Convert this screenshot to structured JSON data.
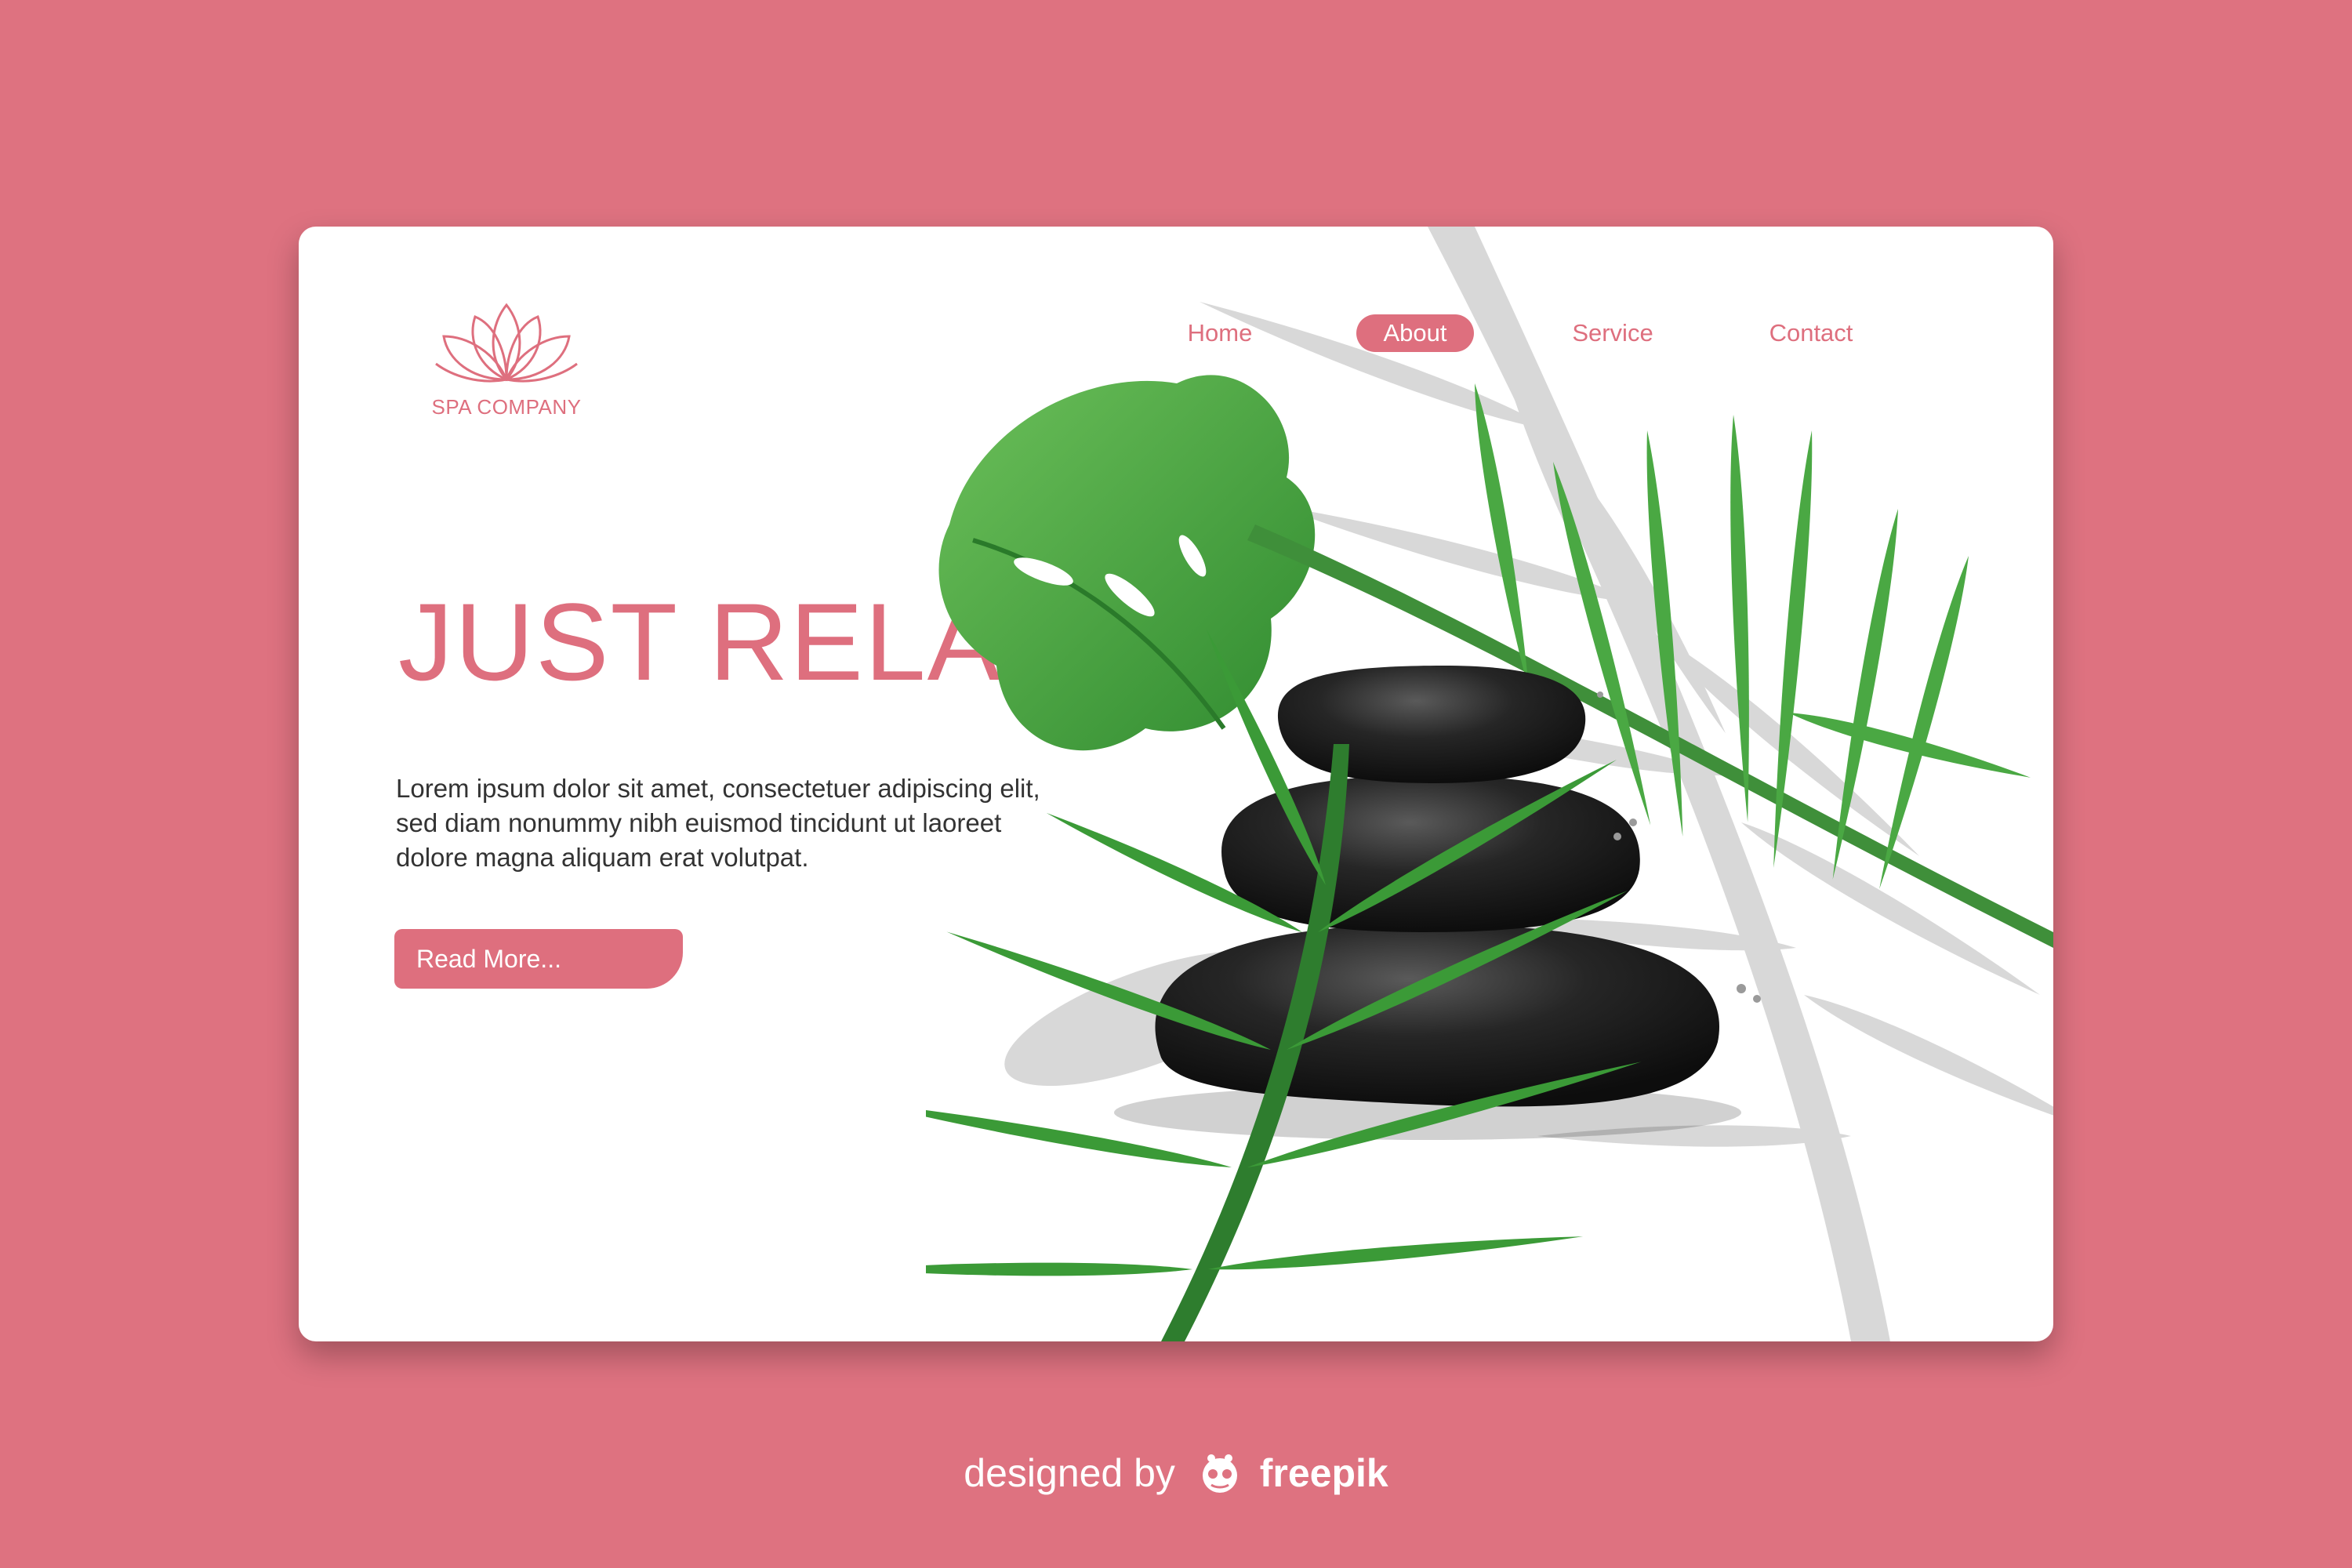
{
  "brand": {
    "name": "SPA COMPANY",
    "logo_icon": "lotus-icon"
  },
  "nav": {
    "items": [
      {
        "label": "Home",
        "active": false
      },
      {
        "label": "About",
        "active": true
      },
      {
        "label": "Service",
        "active": false
      },
      {
        "label": "Contact",
        "active": false
      }
    ]
  },
  "hero": {
    "headline": "JUST RELAX",
    "body_lines": [
      "Lorem ipsum dolor sit amet, consectetuer adipiscing elit,",
      "sed diam nonummy nibh euismod tincidunt ut laoreet",
      "dolore magna aliquam erat volutpat."
    ],
    "cta_label": "Read More..."
  },
  "footer": {
    "prefix": "designed by",
    "brand": "freepik"
  },
  "colors": {
    "background": "#de7280",
    "accent": "#de6f7e",
    "card": "#ffffff",
    "stone": "#1a1a1a",
    "leaf": "#3d9c3a",
    "leaf_shadow": "#d6d6d6"
  }
}
